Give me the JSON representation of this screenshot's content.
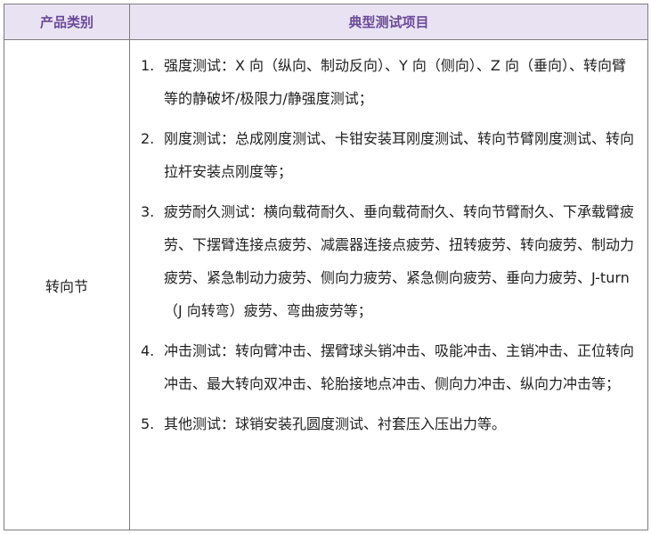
{
  "table": {
    "header": {
      "category": "产品类别",
      "tests": "典型测试项目"
    },
    "category": "转向节",
    "items": [
      {
        "num": "1.",
        "text": "强度测试：X 向（纵向、制动反向）、Y 向（侧向）、Z 向（垂向）、转向臂等的静破坏/极限力/静强度测试；"
      },
      {
        "num": "2.",
        "text": "刚度测试：总成刚度测试、卡钳安装耳刚度测试、转向节臂刚度测试、转向拉杆安装点刚度等；"
      },
      {
        "num": "3.",
        "text": "疲劳耐久测试：横向载荷耐久、垂向载荷耐久、转向节臂耐久、下承载臂疲劳、下摆臂连接点疲劳、减震器连接点疲劳、扭转疲劳、转向疲劳、制动力疲劳、紧急制动力疲劳、侧向力疲劳、紧急侧向疲劳、垂向力疲劳、J-turn（J 向转弯）疲劳、弯曲疲劳等；"
      },
      {
        "num": "4.",
        "text": "冲击测试：转向臂冲击、摆臂球头销冲击、吸能冲击、主销冲击、正位转向冲击、最大转向双冲击、轮胎接地点冲击、侧向力冲击、纵向力冲击等；"
      },
      {
        "num": "5.",
        "text": "其他测试：球销安装孔圆度测试、衬套压入压出力等。"
      }
    ]
  }
}
